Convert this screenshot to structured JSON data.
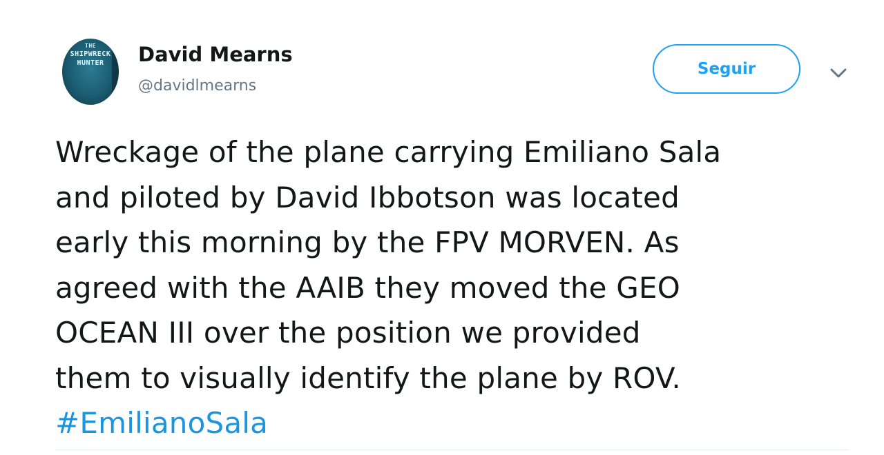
{
  "user": {
    "name": "David Mearns",
    "handle": "@davidlmearns",
    "avatar_book": {
      "line1": "THE",
      "line2": "SHIPWRECK",
      "line3": "HUNTER"
    }
  },
  "follow_button": {
    "label": "Seguir"
  },
  "tweet": {
    "lines": [
      "Wreckage of the plane carrying Emiliano Sala",
      "and piloted by David Ibbotson was located",
      "early this morning by the FPV MORVEN. As",
      "agreed with the AAIB they moved the GEO",
      "OCEAN III over the position we provided",
      "them to visually identify the plane by ROV."
    ],
    "hashtag": "#EmilianoSala"
  },
  "icons": {
    "menu": "chevron-down-icon"
  },
  "colors": {
    "accent": "#1da1f2",
    "hashtag": "#1b95e0",
    "text": "#14171a",
    "secondary_text": "#657786",
    "divider": "#e6ecf0"
  }
}
